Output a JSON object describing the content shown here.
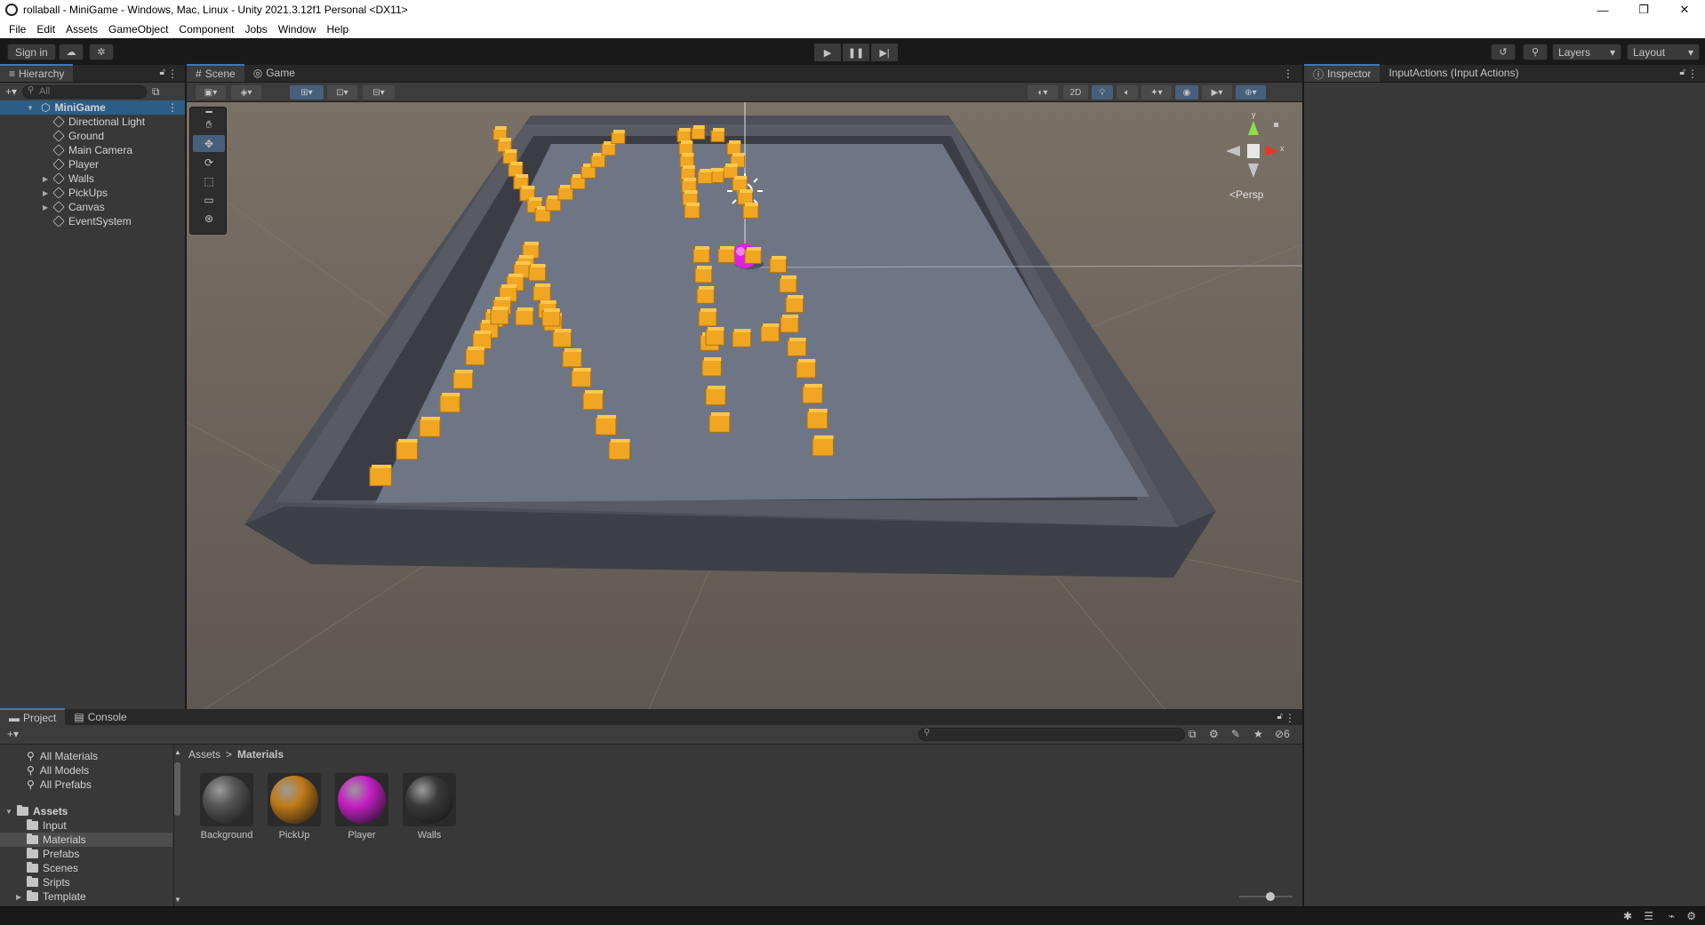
{
  "window": {
    "title": "rollaball - MiniGame - Windows, Mac, Linux - Unity 2021.3.12f1 Personal <DX11>",
    "controls": [
      "—",
      "❐",
      "✕"
    ]
  },
  "menu": [
    "File",
    "Edit",
    "Assets",
    "GameObject",
    "Component",
    "Jobs",
    "Window",
    "Help"
  ],
  "toolbar": {
    "sign_in": "Sign in",
    "layers_label": "Layers",
    "layout_label": "Layout"
  },
  "hierarchy": {
    "tab_label": "Hierarchy",
    "search_placeholder": "All",
    "scene_name": "MiniGame",
    "items": [
      {
        "label": "Directional Light",
        "expandable": false
      },
      {
        "label": "Ground",
        "expandable": false
      },
      {
        "label": "Main Camera",
        "expandable": false
      },
      {
        "label": "Player",
        "expandable": false
      },
      {
        "label": "Walls",
        "expandable": true
      },
      {
        "label": "PickUps",
        "expandable": true
      },
      {
        "label": "Canvas",
        "expandable": true
      },
      {
        "label": "EventSystem",
        "expandable": false
      }
    ]
  },
  "scene": {
    "tabs": [
      "Scene",
      "Game"
    ],
    "active_tab": "Scene",
    "mode_2d": "2D",
    "gizmo_label": "Persp",
    "axis_y": "y",
    "axis_x": "x"
  },
  "inspector": {
    "tab_label": "Inspector",
    "title": "InputActions (Input Actions)"
  },
  "project": {
    "tabs": [
      "Project",
      "Console"
    ],
    "favorites": [
      "All Materials",
      "All Models",
      "All Prefabs"
    ],
    "root_folder": "Assets",
    "folders": [
      {
        "label": "Input",
        "selected": false,
        "expandable": false
      },
      {
        "label": "Materials",
        "selected": true,
        "expandable": false
      },
      {
        "label": "Prefabs",
        "selected": false,
        "expandable": false
      },
      {
        "label": "Scenes",
        "selected": false,
        "expandable": false
      },
      {
        "label": "Sripts",
        "selected": false,
        "expandable": false
      },
      {
        "label": "Template",
        "selected": false,
        "expandable": true
      }
    ],
    "breadcrumb": [
      "Assets",
      "Materials"
    ],
    "hidden_count": "6",
    "assets": [
      {
        "label": "Background",
        "color": "#555555"
      },
      {
        "label": "PickUp",
        "color": "#c07a18"
      },
      {
        "label": "Player",
        "color": "#c51fc5"
      },
      {
        "label": "Walls",
        "color": "#3a3a3a"
      }
    ]
  },
  "colors": {
    "accent": "#3a79bb",
    "pickup": "#f0a622",
    "player": "#e020e0",
    "ground": "#6e7585",
    "walls": "#4a4d55"
  }
}
